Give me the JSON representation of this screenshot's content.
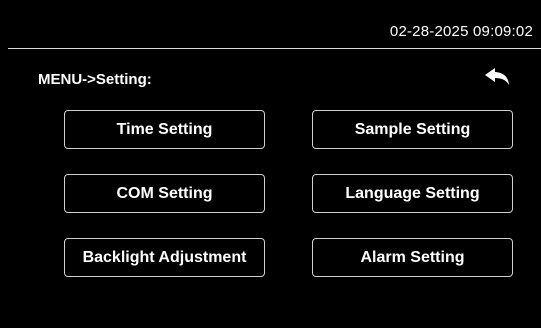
{
  "status_bar": {
    "datetime": "02-28-2025 09:09:02"
  },
  "header": {
    "title": "MENU->Setting:",
    "back_icon": "back-arrow-icon"
  },
  "menu": {
    "items": [
      {
        "label": "Time Setting"
      },
      {
        "label": "Sample Setting"
      },
      {
        "label": "COM Setting"
      },
      {
        "label": "Language Setting"
      },
      {
        "label": "Backlight Adjustment"
      },
      {
        "label": "Alarm Setting"
      }
    ]
  },
  "colors": {
    "background": "#000000",
    "text": "#ffffff",
    "border": "#cfcfcf"
  }
}
